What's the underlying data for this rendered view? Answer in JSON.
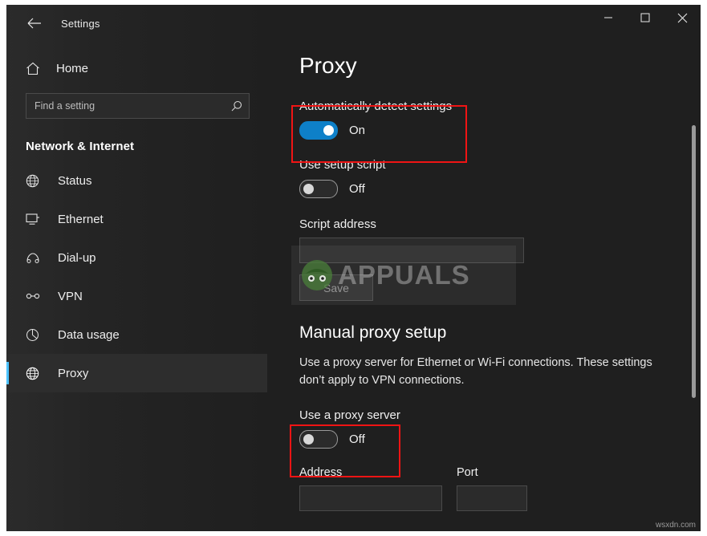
{
  "window": {
    "back_label": "←",
    "app_title": "Settings",
    "minimize": "─",
    "maximize": "☐",
    "close": "✕"
  },
  "sidebar": {
    "home_label": "Home",
    "search": {
      "placeholder": "Find a setting",
      "value": ""
    },
    "section_title": "Network & Internet",
    "items": [
      {
        "label": "Status",
        "icon": "globe-icon",
        "selected": false
      },
      {
        "label": "Ethernet",
        "icon": "ethernet-icon",
        "selected": false
      },
      {
        "label": "Dial-up",
        "icon": "dialup-icon",
        "selected": false
      },
      {
        "label": "VPN",
        "icon": "vpn-icon",
        "selected": false
      },
      {
        "label": "Data usage",
        "icon": "data-usage-icon",
        "selected": false
      },
      {
        "label": "Proxy",
        "icon": "proxy-globe-icon",
        "selected": true
      }
    ]
  },
  "main": {
    "page_title": "Proxy",
    "auto_detect": {
      "label": "Automatically detect settings",
      "state": "On"
    },
    "setup_script": {
      "label": "Use setup script",
      "state": "Off"
    },
    "script_address": {
      "label": "Script address",
      "value": ""
    },
    "save_label": "Save",
    "manual_title": "Manual proxy setup",
    "manual_description": "Use a proxy server for Ethernet or Wi-Fi connections. These settings don’t apply to VPN connections.",
    "use_proxy": {
      "label": "Use a proxy server",
      "state": "Off"
    },
    "address": {
      "label": "Address",
      "value": ""
    },
    "port": {
      "label": "Port",
      "value": ""
    }
  },
  "watermark": {
    "brand": "APPUALS",
    "corner": "wsxdn.com"
  },
  "colors": {
    "accent": "#0e80c8",
    "highlight": "#f01414",
    "selection_bar": "#4cc2ff"
  }
}
